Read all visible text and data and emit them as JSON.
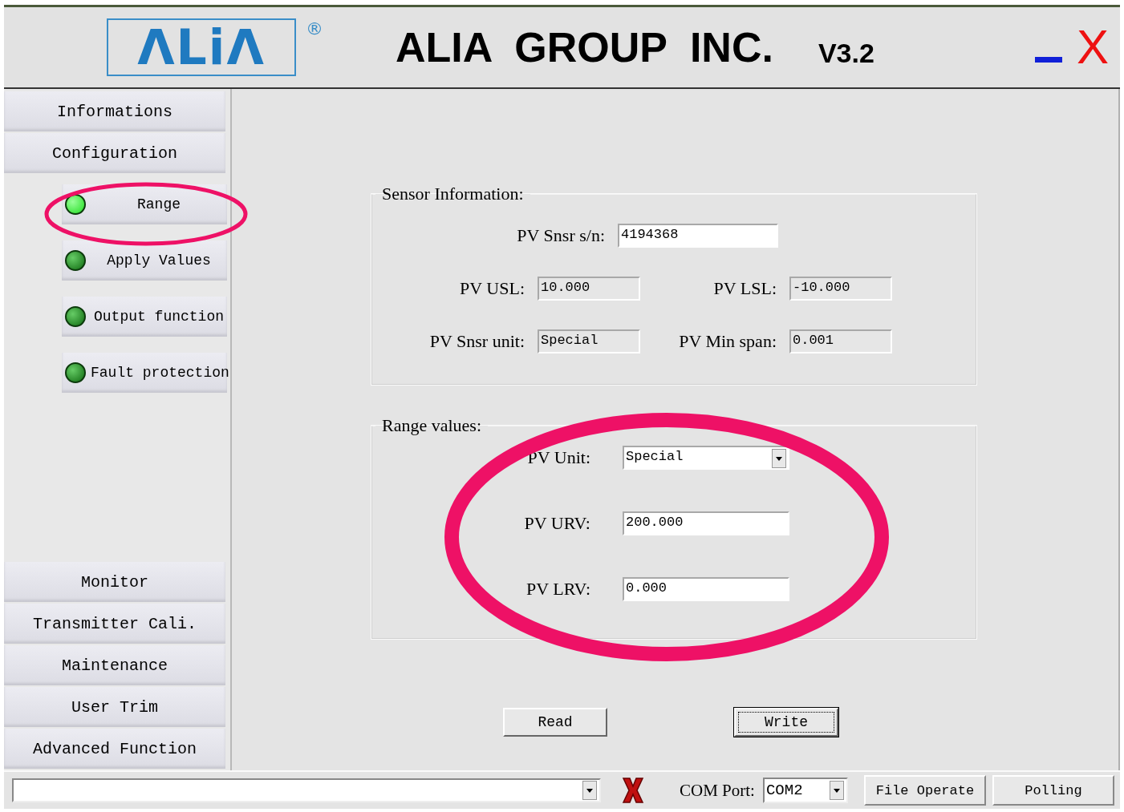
{
  "header": {
    "logo_text": "ΛLiΛ",
    "registered": "®",
    "title": "ALIA  GROUP  INC.",
    "version": "V3.2",
    "close": "X"
  },
  "sidebar": {
    "top_items": [
      {
        "label": "Informations"
      },
      {
        "label": "Configuration"
      }
    ],
    "sub_items": [
      {
        "label": "Range",
        "selected": true
      },
      {
        "label": "Apply Values",
        "selected": false
      },
      {
        "label": "Output function",
        "selected": false
      },
      {
        "label": "Fault protection",
        "selected": false
      }
    ],
    "bottom_items": [
      {
        "label": "Monitor"
      },
      {
        "label": "Transmitter Cali."
      },
      {
        "label": "Maintenance"
      },
      {
        "label": "User Trim"
      },
      {
        "label": "Advanced Function"
      }
    ]
  },
  "sensor_info": {
    "title": "Sensor Information:",
    "serial": {
      "label": "PV Snsr s/n:",
      "value": "4194368",
      "readonly": false
    },
    "fields": [
      {
        "label": "PV USL:",
        "value": "10.000",
        "readonly": true
      },
      {
        "label": "PV LSL:",
        "value": "-10.000",
        "readonly": true
      },
      {
        "label": "PV Snsr unit:",
        "value": "Special",
        "readonly": true
      },
      {
        "label": "PV Min span:",
        "value": "0.001",
        "readonly": true
      }
    ]
  },
  "range_values": {
    "title": "Range values:",
    "fields": [
      {
        "label": "PV Unit:",
        "value": "Special",
        "kind": "dropdown"
      },
      {
        "label": "PV URV:",
        "value": "200.000",
        "kind": "text"
      },
      {
        "label": "PV LRV:",
        "value": "0.000",
        "kind": "text"
      }
    ]
  },
  "buttons": [
    {
      "label": "Read",
      "focused": false
    },
    {
      "label": "Write",
      "focused": true
    }
  ],
  "status_bar": {
    "com_port_label": "COM Port:",
    "com_port_value": "COM2",
    "buttons": [
      "File Operate",
      "Polling"
    ]
  }
}
